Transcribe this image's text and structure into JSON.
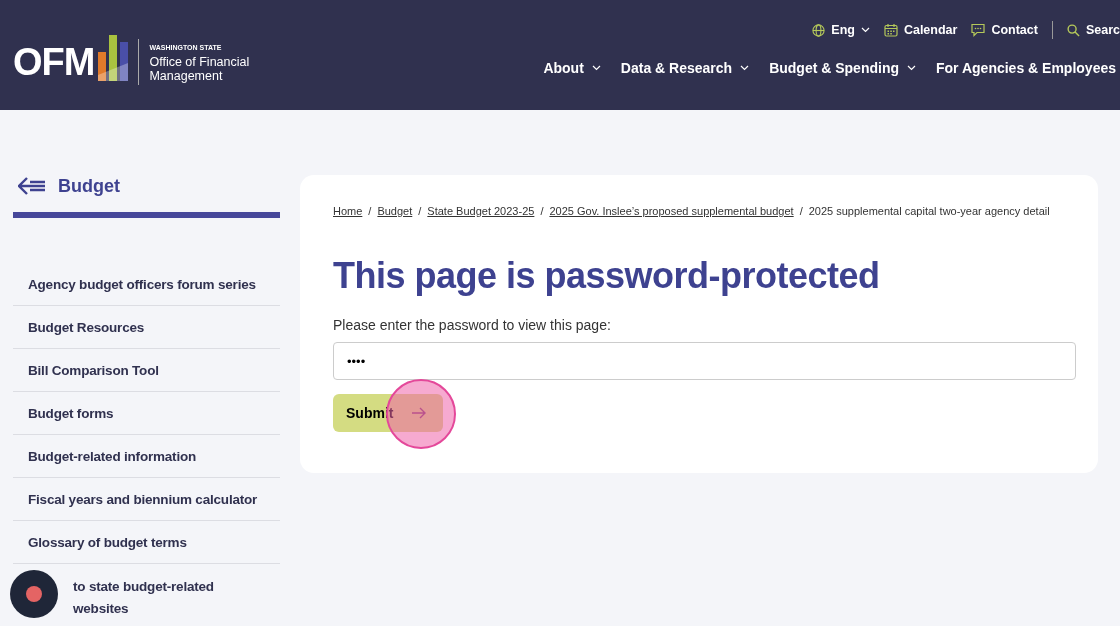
{
  "header": {
    "logo": {
      "wordmark": "OFM",
      "state": "WASHINGTON STATE",
      "name_line1": "Office of Financial",
      "name_line2": "Management"
    },
    "utility": [
      {
        "kind": "language",
        "label": "Eng"
      },
      {
        "kind": "calendar",
        "label": "Calendar"
      },
      {
        "kind": "contact",
        "label": "Contact"
      },
      {
        "kind": "search",
        "label": "Searc"
      }
    ],
    "nav": [
      {
        "label": "About",
        "dropdown": true
      },
      {
        "label": "Data & Research",
        "dropdown": true
      },
      {
        "label": "Budget & Spending",
        "dropdown": true
      },
      {
        "label": "For Agencies & Employees",
        "dropdown": false
      }
    ]
  },
  "sidebar": {
    "title": "Budget",
    "items": [
      "Agency budget officers forum series",
      "Budget Resources",
      "Bill Comparison Tool",
      "Budget forms",
      "Budget-related information",
      "Fiscal years and biennium calculator",
      "Glossary of budget terms",
      "to state budget-related websites"
    ]
  },
  "breadcrumbs": [
    {
      "label": "Home",
      "link": true
    },
    {
      "separator": "/",
      "label": "Budget",
      "link": true
    },
    {
      "separator": "/",
      "label": "State Budget 2023-25",
      "link": true
    },
    {
      "separator": "/",
      "label": "2025 Gov. Inslee’s proposed supplemental budget",
      "link": true
    },
    {
      "separator": "/",
      "label": "2025 supplemental capital two-year agency detail",
      "link": false
    }
  ],
  "main": {
    "heading": "This page is password-protected",
    "prompt": "Please enter the password to view this page:",
    "password_value": "••••",
    "submit": "Submit"
  }
}
